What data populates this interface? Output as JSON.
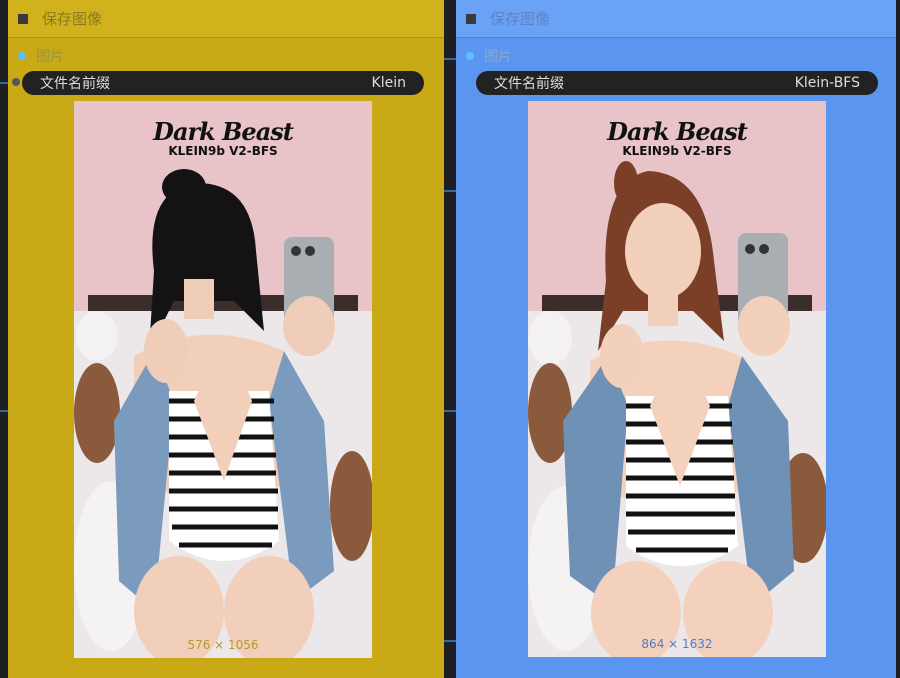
{
  "nodes": [
    {
      "title": "保存图像",
      "input_label": "图片",
      "widget_label": "文件名前缀",
      "widget_value": "Klein",
      "logo_main": "Dark Beast",
      "logo_sub": "KLEIN9b V2-BFS",
      "size_text": "576 × 1056"
    },
    {
      "title": "保存图像",
      "input_label": "图片",
      "widget_label": "文件名前缀",
      "widget_value": "Klein-BFS",
      "logo_main": "Dark Beast",
      "logo_sub": "KLEIN9b V2-BFS",
      "size_text": "864 × 1632"
    }
  ],
  "colors": {
    "node1_bg": "#c9aa16",
    "node2_bg": "#5a95f0",
    "canvas_bg": "#1e1f22",
    "wire": "#4aa8ff"
  }
}
